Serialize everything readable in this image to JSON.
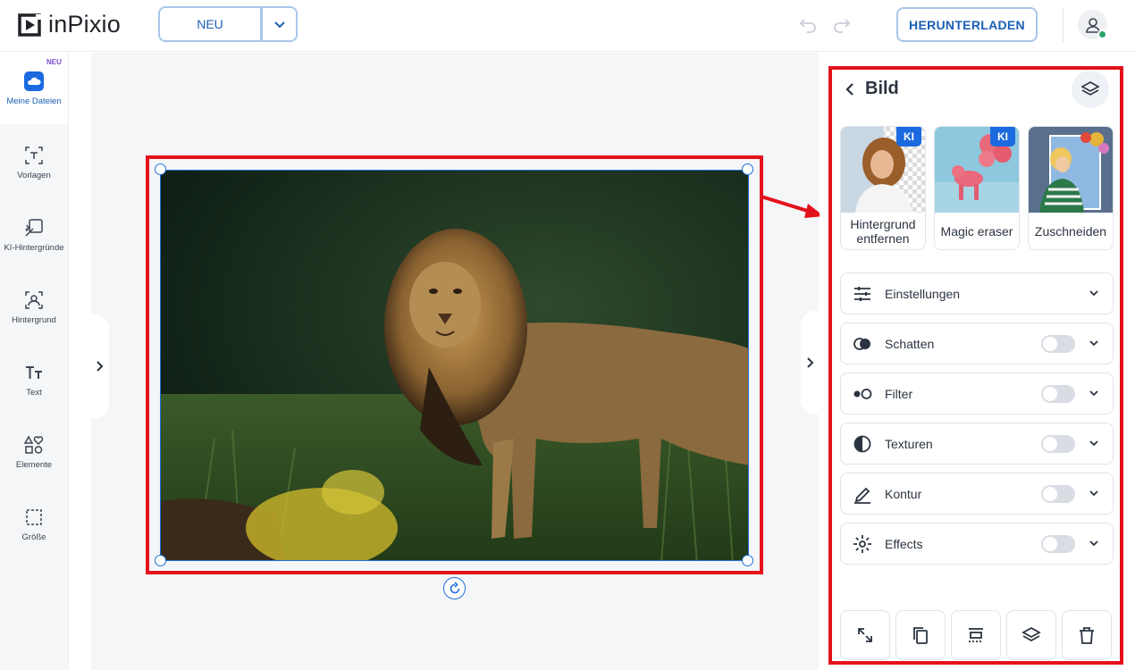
{
  "app": {
    "logo_text": "inPixio"
  },
  "header": {
    "new_button_label": "NEU",
    "download_button_label": "HERUNTERLADEN"
  },
  "sidebar": {
    "new_tag": "NEU",
    "items": [
      {
        "label": "Meine Dateien",
        "icon": "cloud-icon",
        "active": true
      },
      {
        "label": "Vorlagen",
        "icon": "template-icon"
      },
      {
        "label": "KI-Hintergründe",
        "icon": "ai-background-icon"
      },
      {
        "label": "Hintergrund",
        "icon": "background-icon"
      },
      {
        "label": "Text",
        "icon": "text-icon"
      },
      {
        "label": "Elemente",
        "icon": "elements-icon"
      },
      {
        "label": "Größe",
        "icon": "resize-icon"
      }
    ]
  },
  "panel": {
    "title": "Bild",
    "tools": [
      {
        "label": "Hintergrund entfernen",
        "badge": "KI"
      },
      {
        "label": "Magic eraser",
        "badge": "KI"
      },
      {
        "label": "Zuschneiden",
        "badge": ""
      }
    ],
    "sections": [
      {
        "label": "Einstellungen",
        "icon": "sliders-icon",
        "has_toggle": false
      },
      {
        "label": "Schatten",
        "icon": "shadow-icon",
        "has_toggle": true
      },
      {
        "label": "Filter",
        "icon": "filter-icon",
        "has_toggle": true
      },
      {
        "label": "Texturen",
        "icon": "texture-icon",
        "has_toggle": true
      },
      {
        "label": "Kontur",
        "icon": "pen-icon",
        "has_toggle": true
      },
      {
        "label": "Effects",
        "icon": "sparkle-icon",
        "has_toggle": true
      }
    ],
    "bottom_actions": [
      "resize-arrows-icon",
      "duplicate-icon",
      "align-icon",
      "layers-icon",
      "trash-icon"
    ]
  },
  "colors": {
    "accent": "#1a5fb4",
    "highlight_frame": "#e3121a",
    "ki_badge": "#1b6ae0"
  }
}
